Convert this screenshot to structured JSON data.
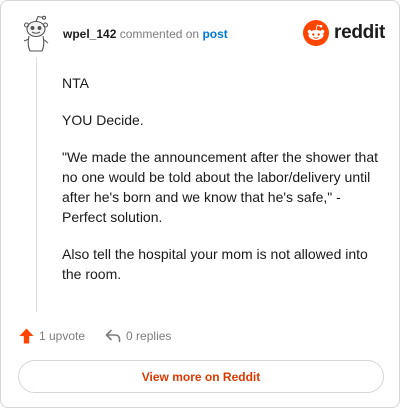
{
  "comment": {
    "username": "wpel_142",
    "action_text": "commented on",
    "post_link": "post",
    "avatar_icon": "snoo-avatar-icon"
  },
  "brand": {
    "icon": "reddit-snoo-icon",
    "wordmark": "reddit",
    "accent": "#ff4500"
  },
  "body": {
    "paragraphs": [
      "NTA",
      "YOU Decide.",
      "\"We made the announcement after the shower that no one would be told about the labor/delivery until after he's born and we know that he's safe,\" - Perfect solution.",
      "Also tell the hospital your mom is not allowed into the room."
    ]
  },
  "actions": {
    "upvote_icon": "upvote-arrow-icon",
    "upvote_label": "1 upvote",
    "reply_icon": "reply-arrow-icon",
    "replies_label": "0 replies"
  },
  "footer": {
    "view_more_label": "View more on Reddit",
    "link_color": "#d93a00"
  }
}
